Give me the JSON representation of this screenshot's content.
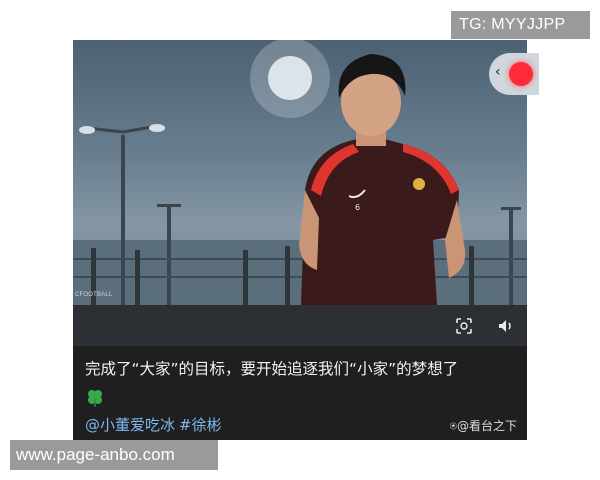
{
  "watermark_top": "TG: MYYJJPP",
  "watermark_bottom": "www.page-anbo.com",
  "photo": {
    "watermark": "CFOOTBALL"
  },
  "caption": {
    "text": "完成了“大家”的目标，要开始追逐我们“小家”的梦想了"
  },
  "author": {
    "handle": "@小董爱吃冰",
    "hashtag": "#徐彬"
  },
  "source": {
    "text": "看台之下"
  },
  "icons": {
    "scan": "scan-icon",
    "volume": "volume-icon",
    "clover": "four-leaf-clover-icon",
    "source_logo": "tv-icon"
  },
  "colors": {
    "jersey": "#3a1a1a",
    "jersey_accent": "#e0342e",
    "link": "#7eb7ef",
    "record_dot": "#ff2a3a"
  }
}
